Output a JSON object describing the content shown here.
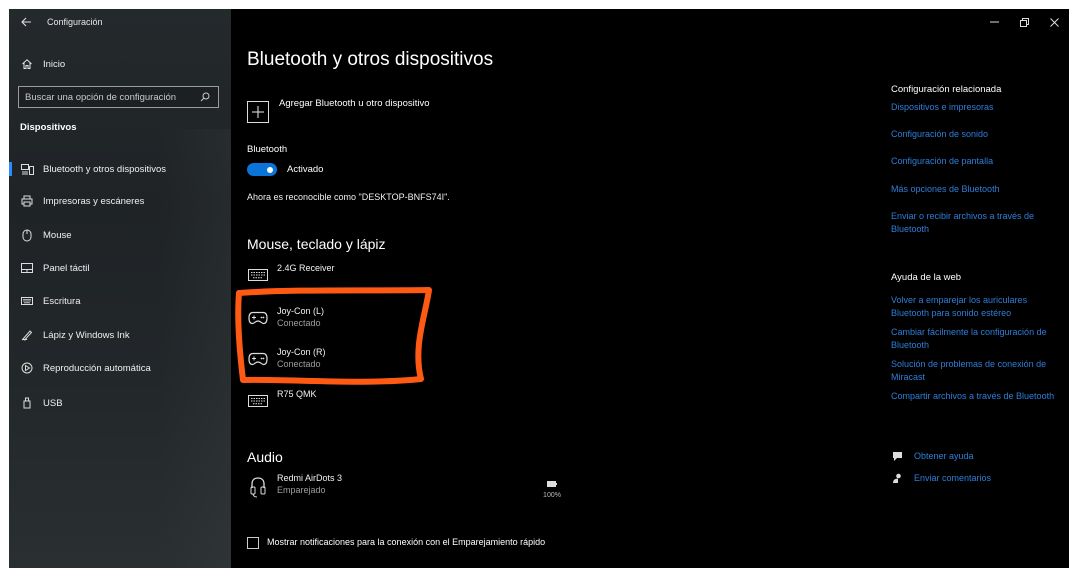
{
  "window": {
    "title": "Configuración",
    "controls": [
      "minimize",
      "restore",
      "close"
    ]
  },
  "sidebar": {
    "home_label": "Inicio",
    "search_placeholder": "Buscar una opción de configuración",
    "section": "Dispositivos",
    "items": [
      {
        "label": "Bluetooth y otros dispositivos",
        "icon": "bluetooth-devices-icon",
        "active": true
      },
      {
        "label": "Impresoras y escáneres",
        "icon": "printer-icon"
      },
      {
        "label": "Mouse",
        "icon": "mouse-icon"
      },
      {
        "label": "Panel táctil",
        "icon": "touchpad-icon"
      },
      {
        "label": "Escritura",
        "icon": "keyboard-icon"
      },
      {
        "label": "Lápiz y Windows Ink",
        "icon": "pen-icon"
      },
      {
        "label": "Reproducción automática",
        "icon": "autoplay-icon"
      },
      {
        "label": "USB",
        "icon": "usb-icon"
      }
    ]
  },
  "main": {
    "title": "Bluetooth y otros dispositivos",
    "add_device_label": "Agregar Bluetooth u otro dispositivo",
    "bluetooth_label": "Bluetooth",
    "bluetooth_state": "Activado",
    "discoverable_text": "Ahora es reconocible como \"DESKTOP-BNFS74I\".",
    "group_input_title": "Mouse, teclado y lápiz",
    "input_devices": [
      {
        "name": "2.4G Receiver",
        "status": "",
        "icon": "keyboard-icon"
      },
      {
        "name": "Joy-Con (L)",
        "status": "Conectado",
        "icon": "gamepad-icon"
      },
      {
        "name": "Joy-Con (R)",
        "status": "Conectado",
        "icon": "gamepad-icon"
      },
      {
        "name": "R75 QMK",
        "status": "",
        "icon": "keyboard-icon"
      }
    ],
    "group_audio_title": "Audio",
    "audio_devices": [
      {
        "name": "Redmi AirDots 3",
        "status": "Emparejado",
        "icon": "headphones-icon",
        "battery": "100%"
      }
    ],
    "notify_label": "Mostrar notificaciones para la conexión con el Emparejamiento rápido"
  },
  "related": {
    "title": "Configuración relacionada",
    "links": [
      "Dispositivos e impresoras",
      "Configuración de sonido",
      "Configuración de pantalla",
      "Más opciones de Bluetooth",
      "Enviar o recibir archivos a través de Bluetooth"
    ]
  },
  "help": {
    "title": "Ayuda de la web",
    "links": [
      "Volver a emparejar los auriculares Bluetooth para sonido estéreo",
      "Cambiar fácilmente la configuración de Bluetooth",
      "Solución de problemas de conexión de Miracast",
      "Compartir archivos a través de Bluetooth"
    ],
    "get_help": "Obtener ayuda",
    "feedback": "Enviar comentarios"
  },
  "colors": {
    "accent": "#0a74d8",
    "link": "#2f7ed8",
    "annotation": "#ff5a14",
    "background": "#000000"
  }
}
